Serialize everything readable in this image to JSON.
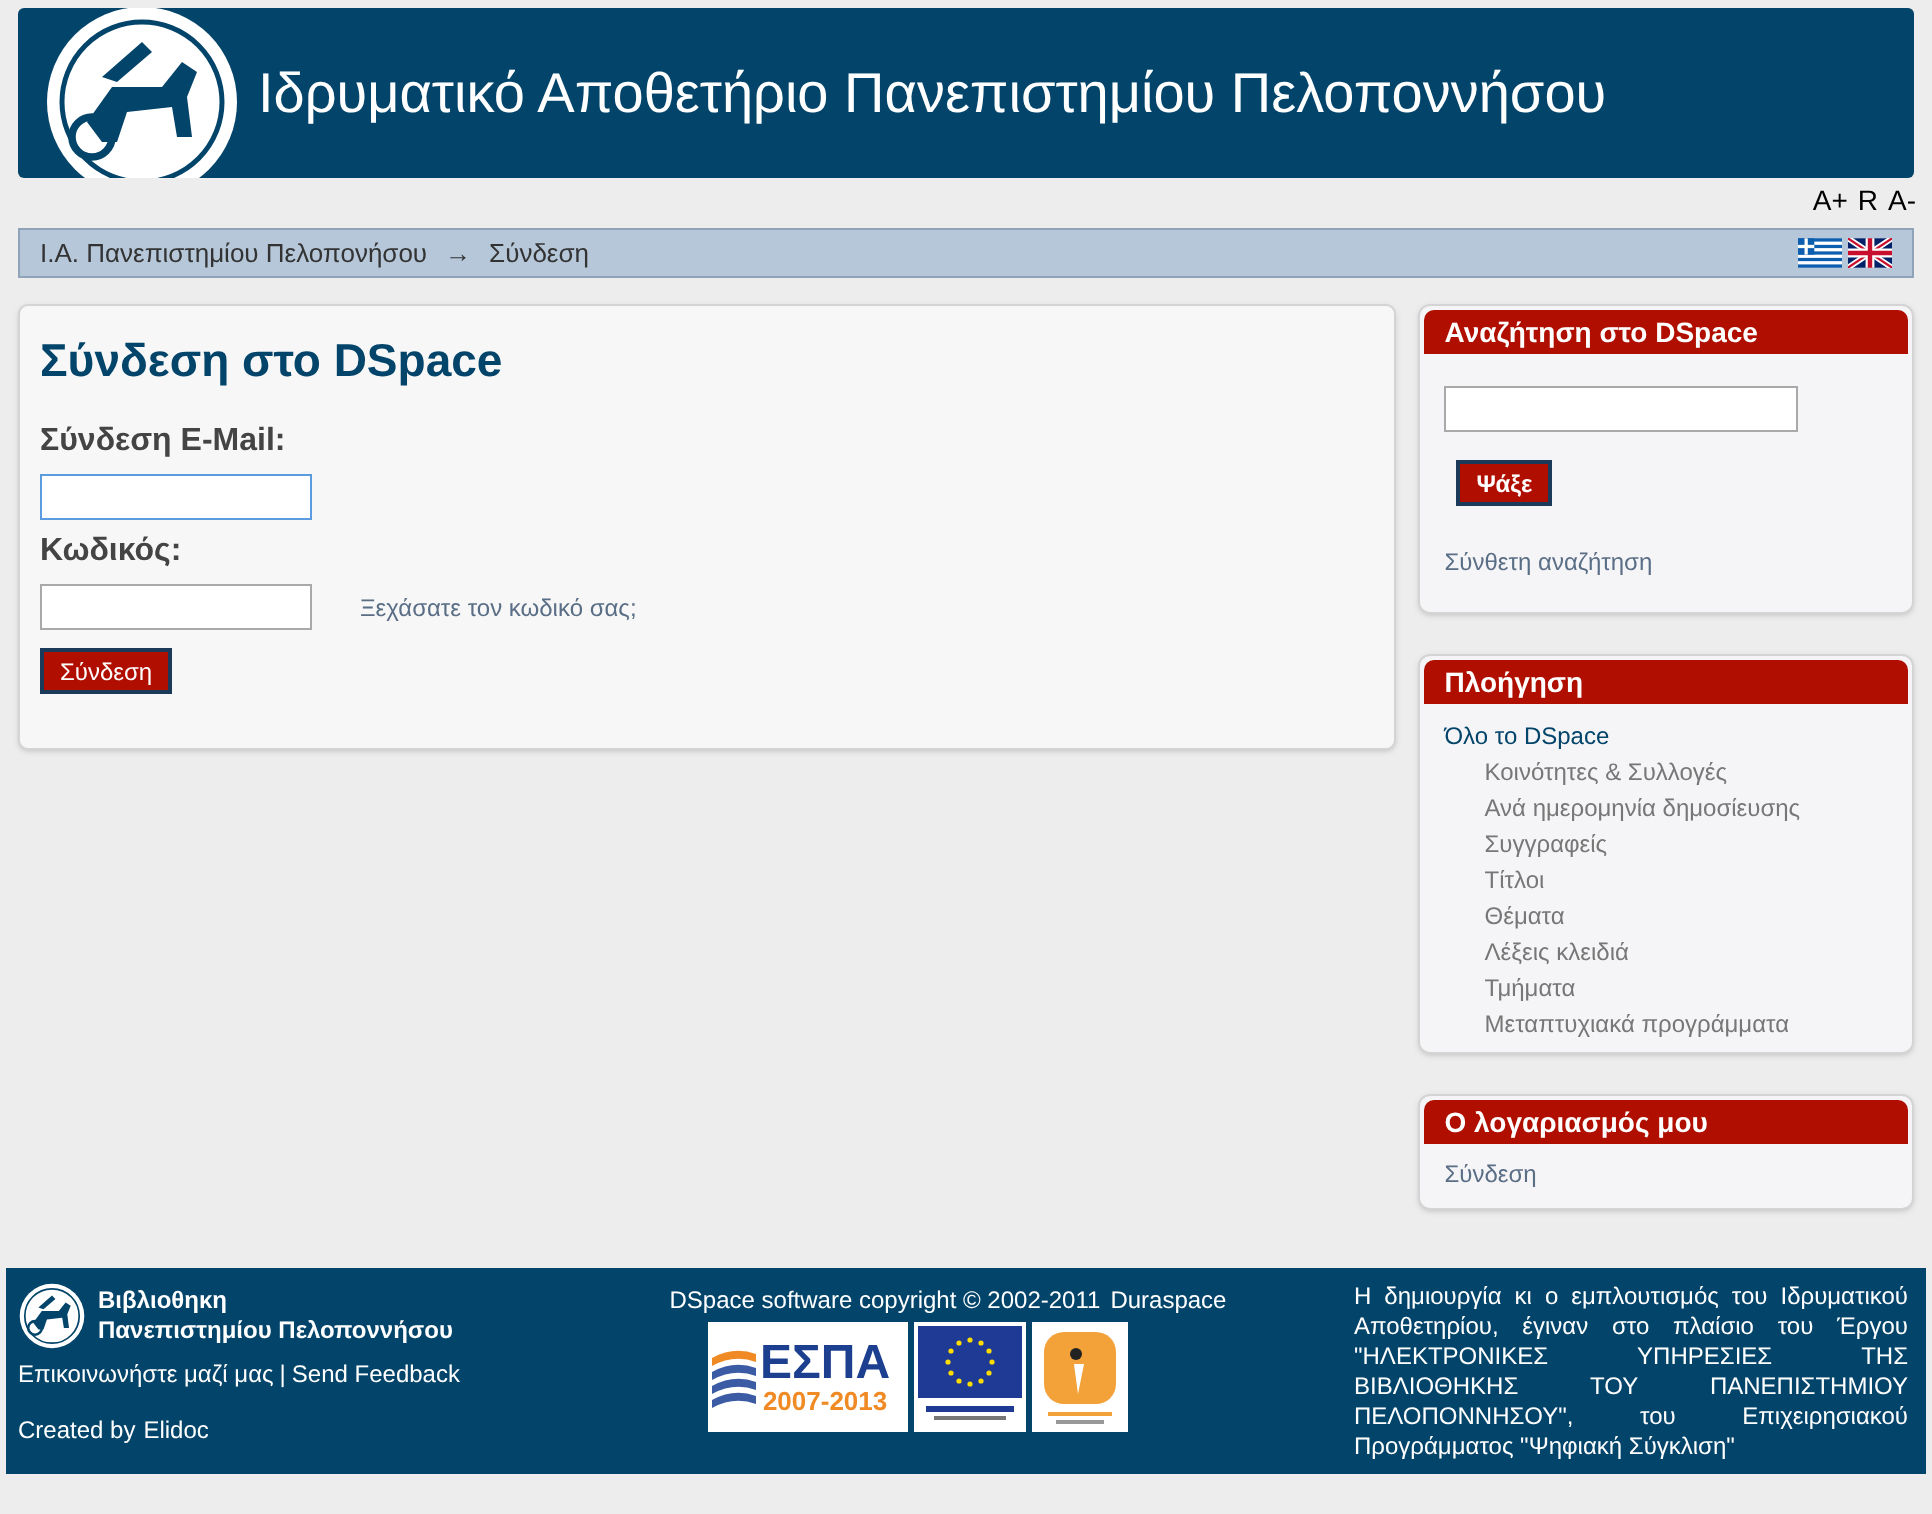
{
  "header": {
    "title": "Ιδρυματικό Αποθετήριο Πανεπιστημίου Πελοποννήσου"
  },
  "font_size_controls": [
    "A+",
    "R",
    "A-"
  ],
  "breadcrumb": {
    "items": [
      "Ι.Α. Πανεπιστημίου Πελοπονήσου",
      "Σύνδεση"
    ],
    "separator": "→"
  },
  "languages": [
    {
      "kind": "greek"
    },
    {
      "kind": "english"
    }
  ],
  "login": {
    "title": "Σύνδεση στο DSpace",
    "email_label": "Σύνδεση E-Mail:",
    "email_focused": true,
    "password_label": "Κωδικός:",
    "forgot_link": "Ξεχάσατε τον κωδικό σας;",
    "submit": "Σύνδεση"
  },
  "search_box": {
    "title": "Αναζήτηση στο DSpace",
    "button": "Ψάξε",
    "advanced_link": "Σύνθετη αναζήτηση"
  },
  "navigation": {
    "title": "Πλοήγηση",
    "items": [
      {
        "label": "Όλο το DSpace",
        "children": [
          {
            "label": "Κοινότητες & Συλλογές"
          },
          {
            "label": "Ανά ημερομηνία δημοσίευσης"
          },
          {
            "label": "Συγγραφείς"
          },
          {
            "label": "Τίτλοι"
          },
          {
            "label": "Θέματα"
          },
          {
            "label": "Λέξεις κλειδιά"
          },
          {
            "label": "Τμήματα"
          },
          {
            "label": "Μεταπτυχιακά προγράμματα"
          }
        ]
      }
    ]
  },
  "account": {
    "title": "Ο λογαριασμός μου",
    "items": [
      "Σύνδεση"
    ]
  },
  "footer": {
    "library_name": [
      "Βιβλιοθηκη",
      "Πανεπιστημίου Πελοποννήσου"
    ],
    "contact_link": "Επικοινωνήστε μαζί μας",
    "divider": "|",
    "feedback_link": "Send Feedback",
    "created_by": "Created by",
    "creator_link": "Elidoc",
    "copyright": "DSpace software copyright © 2002-2011",
    "copyright_link": "Duraspace",
    "espa_logo": {
      "letters": "ΕΣΠΑ",
      "years": "2007-2013"
    },
    "funding_note": "Η δημιουργία κι ο εμπλουτισμός του Ιδρυματικού Αποθετηρίου, έγιναν στο πλαίσιο του Έργου \"ΗΛΕΚΤΡΟΝΙΚΕΣ ΥΠΗΡΕΣΙΕΣ ΤΗΣ ΒΙΒΛΙΟΘΗΚΗΣ ΤΟΥ ΠΑΝΕΠΙΣΤΗΜΙΟΥ ΠΕΛΟΠΟΝΝΗΣΟΥ\", του Επιχειρησιακού Προγράμματος \"Ψηφιακή Σύγκλιση\""
  }
}
